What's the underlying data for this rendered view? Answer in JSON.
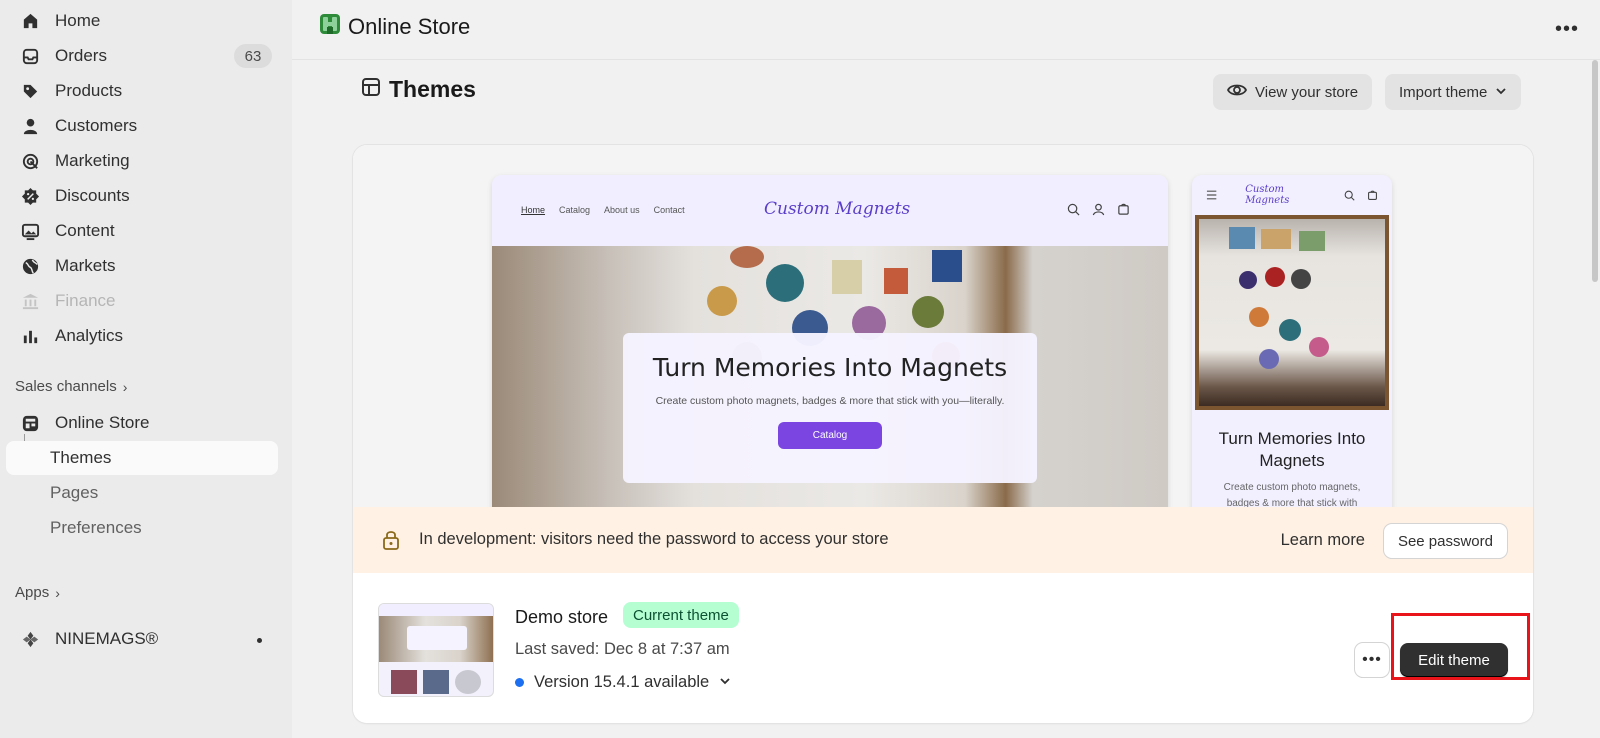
{
  "sidebar": {
    "items": [
      {
        "label": "Home",
        "icon": "home-icon"
      },
      {
        "label": "Orders",
        "icon": "inbox-icon",
        "badge": "63"
      },
      {
        "label": "Products",
        "icon": "tag-icon"
      },
      {
        "label": "Customers",
        "icon": "person-icon"
      },
      {
        "label": "Marketing",
        "icon": "target-icon"
      },
      {
        "label": "Discounts",
        "icon": "discount-icon"
      },
      {
        "label": "Content",
        "icon": "image-icon"
      },
      {
        "label": "Markets",
        "icon": "globe-icon"
      },
      {
        "label": "Finance",
        "icon": "bank-icon",
        "disabled": true
      },
      {
        "label": "Analytics",
        "icon": "bar-chart-icon"
      }
    ],
    "sales_channels_label": "Sales channels",
    "online_store_label": "Online Store",
    "sub_items": [
      "Themes",
      "Pages",
      "Preferences"
    ],
    "apps_label": "Apps",
    "app_name": "NINEMAGS®"
  },
  "header": {
    "title": "Online Store",
    "more_label": "•••"
  },
  "page": {
    "title": "Themes",
    "view_store_label": "View your store",
    "import_theme_label": "Import theme"
  },
  "preview": {
    "desktop_links": [
      "Home",
      "Catalog",
      "About us",
      "Contact"
    ],
    "logo_text": "Custom Magnets",
    "hero_title": "Turn Memories Into Magnets",
    "hero_text": "Create custom photo magnets, badges & more that stick with you—literally.",
    "cta_label": "Catalog",
    "mobile_title": "Turn Memories Into Magnets",
    "mobile_text": "Create custom photo magnets, badges & more that stick with"
  },
  "banner": {
    "message": "In development: visitors need the password to access your store",
    "learn_more": "Learn more",
    "see_password": "See password"
  },
  "theme": {
    "name": "Demo store",
    "badge": "Current theme",
    "last_saved": "Last saved: Dec 8 at 7:37 am",
    "version": "Version 15.4.1 available",
    "more_label": "•••",
    "edit_label": "Edit theme"
  },
  "colors": {
    "accent": "#7a45e0",
    "badge_green": "#b4fed2",
    "banner_bg": "#fff1e3",
    "highlight": "#e8141a"
  }
}
